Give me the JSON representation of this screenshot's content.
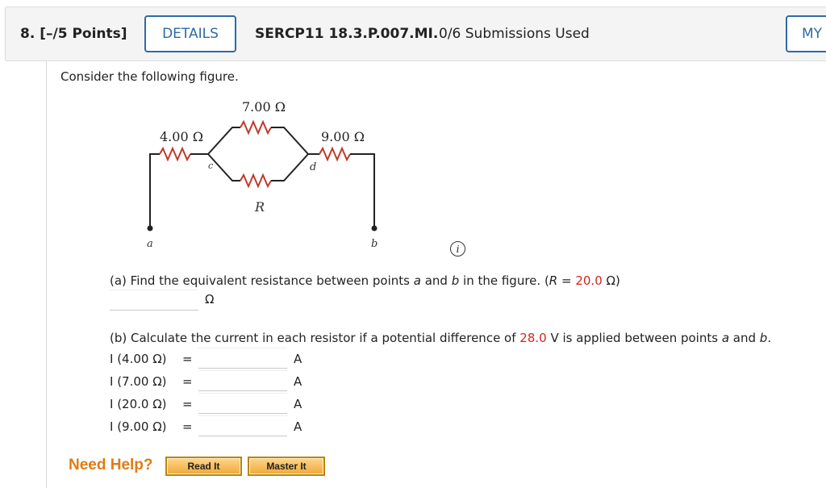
{
  "header": {
    "question_number": "8.",
    "points": "[–/5 Points]",
    "details_label": "DETAILS",
    "question_code": "SERCP11 18.3.P.007.MI.",
    "submissions": "0/6 Submissions Used",
    "my_notes_label": "MY"
  },
  "prompt": "Consider the following figure.",
  "figure": {
    "r1": "4.00 Ω",
    "r2": "7.00 Ω",
    "r3": "9.00 Ω",
    "r_label": "R",
    "node_a": "a",
    "node_b": "b",
    "node_c": "c",
    "node_d": "d"
  },
  "part_a": {
    "prefix": "(a) Find the equivalent resistance between points ",
    "a": "a",
    "mid": " and ",
    "b": "b",
    "suffix": " in the figure. (",
    "r_var": "R",
    "eq": " = ",
    "r_value": "20.0",
    "r_unit": " Ω)",
    "answer_unit": "Ω"
  },
  "part_b": {
    "prefix": "(b) Calculate the current in each resistor if a potential difference of ",
    "voltage": "28.0",
    "suffix1": " V is applied between points ",
    "a": "a",
    "mid": " and ",
    "b": "b",
    "end": ".",
    "rows": [
      {
        "label": "I (4.00 Ω)",
        "eq": "=",
        "unit": "A"
      },
      {
        "label": "I (7.00 Ω)",
        "eq": "=",
        "unit": "A"
      },
      {
        "label": "I (20.0 Ω)",
        "eq": "=",
        "unit": "A"
      },
      {
        "label": "I (9.00 Ω)",
        "eq": "=",
        "unit": "A"
      }
    ]
  },
  "help": {
    "label": "Need Help?",
    "read_it": "Read It",
    "master_it": "Master It"
  },
  "colors": {
    "accent_blue": "#2f6aa6",
    "given_red": "#d0271d",
    "help_orange": "#e07b14"
  },
  "icons": {
    "info": "info-circle-icon"
  }
}
